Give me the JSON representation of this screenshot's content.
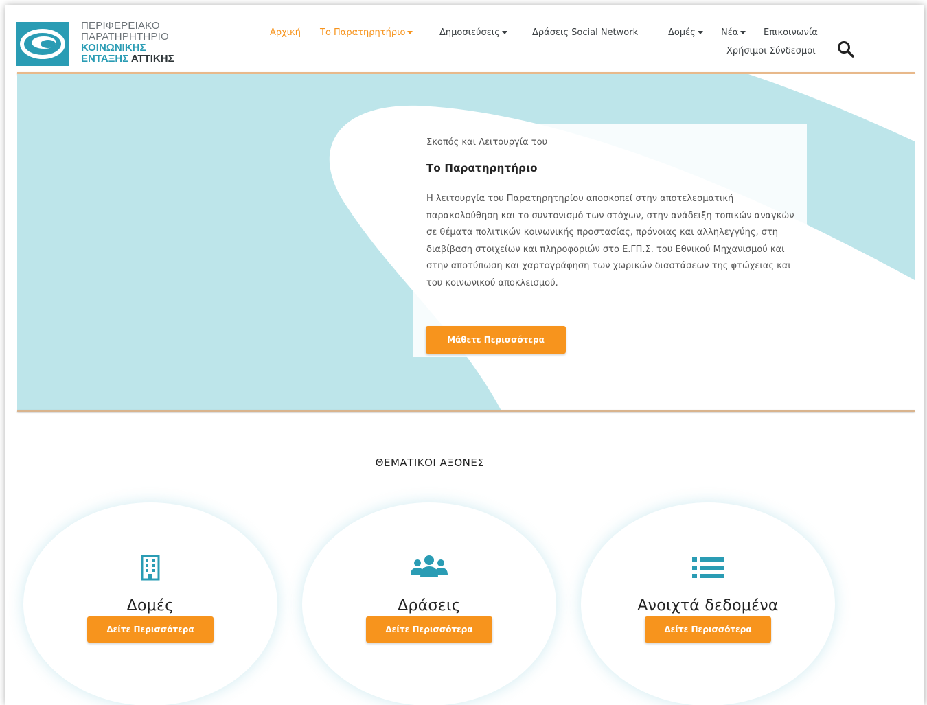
{
  "logo": {
    "line1": "ΠΕΡΙΦΕΡΕΙΑΚΟ",
    "line2": "ΠΑΡΑΤΗΡΗΤΗΡΙΟ",
    "line3": "ΚΟΙΝΩΝΙΚΗΣ",
    "line4a": "ΕΝΤΑΞΗΣ",
    "line4b": "ΑΤΤΙΚΗΣ"
  },
  "nav": {
    "items": [
      {
        "label": "Αρχική"
      },
      {
        "label": "Το Παρατηρητήριο"
      },
      {
        "label": "Δημοσιεύσεις"
      },
      {
        "label": "Δράσεις Social Network"
      },
      {
        "label": "Δομές"
      },
      {
        "label": "Νέα"
      },
      {
        "label": "Επικοινωνία"
      },
      {
        "label": "Χρήσιμοι Σύνδεσμοι"
      }
    ],
    "search_icon": "search-icon"
  },
  "hero": {
    "kicker": "Σκοπός και Λειτουργία του",
    "title": "Το Παρατηρητήριο",
    "body": "Η λειτουργία του Παρατηρητηρίου αποσκοπεί στην αποτελεσματική παρακολούθηση και το συντονισμό των στόχων, στην ανάδειξη τοπικών αναγκών σε θέματα πολιτικών κοινωνικής προστασίας, πρόνοιας και αλληλεγγύης, στη διαβίβαση στοιχείων και πληροφοριών στο Ε.ΓΠ.Σ. του Εθνικού Μηχανισμού και στην αποτύπωση και χαρτογράφηση των χωρικών διαστάσεων της φτώχειας και του κοινωνικού αποκλεισμού.",
    "button": "Μάθετε Περισσότερα"
  },
  "section": {
    "title": "ΘΕΜΑΤΙΚΟΙ ΑΞΟΝΕΣ",
    "axes": [
      {
        "label": "Δομές",
        "icon": "building-icon",
        "button": "Δείτε Περισσότερα"
      },
      {
        "label": "Δράσεις",
        "icon": "users-icon",
        "button": "Δείτε Περισσότερα"
      },
      {
        "label": "Ανοιχτά δεδομένα",
        "icon": "list-icon",
        "button": "Δείτε Περισσότερα"
      }
    ]
  },
  "colors": {
    "accent": "#f7941d",
    "teal": "#2a9cb4",
    "hero_bg": "#bde5ea"
  }
}
